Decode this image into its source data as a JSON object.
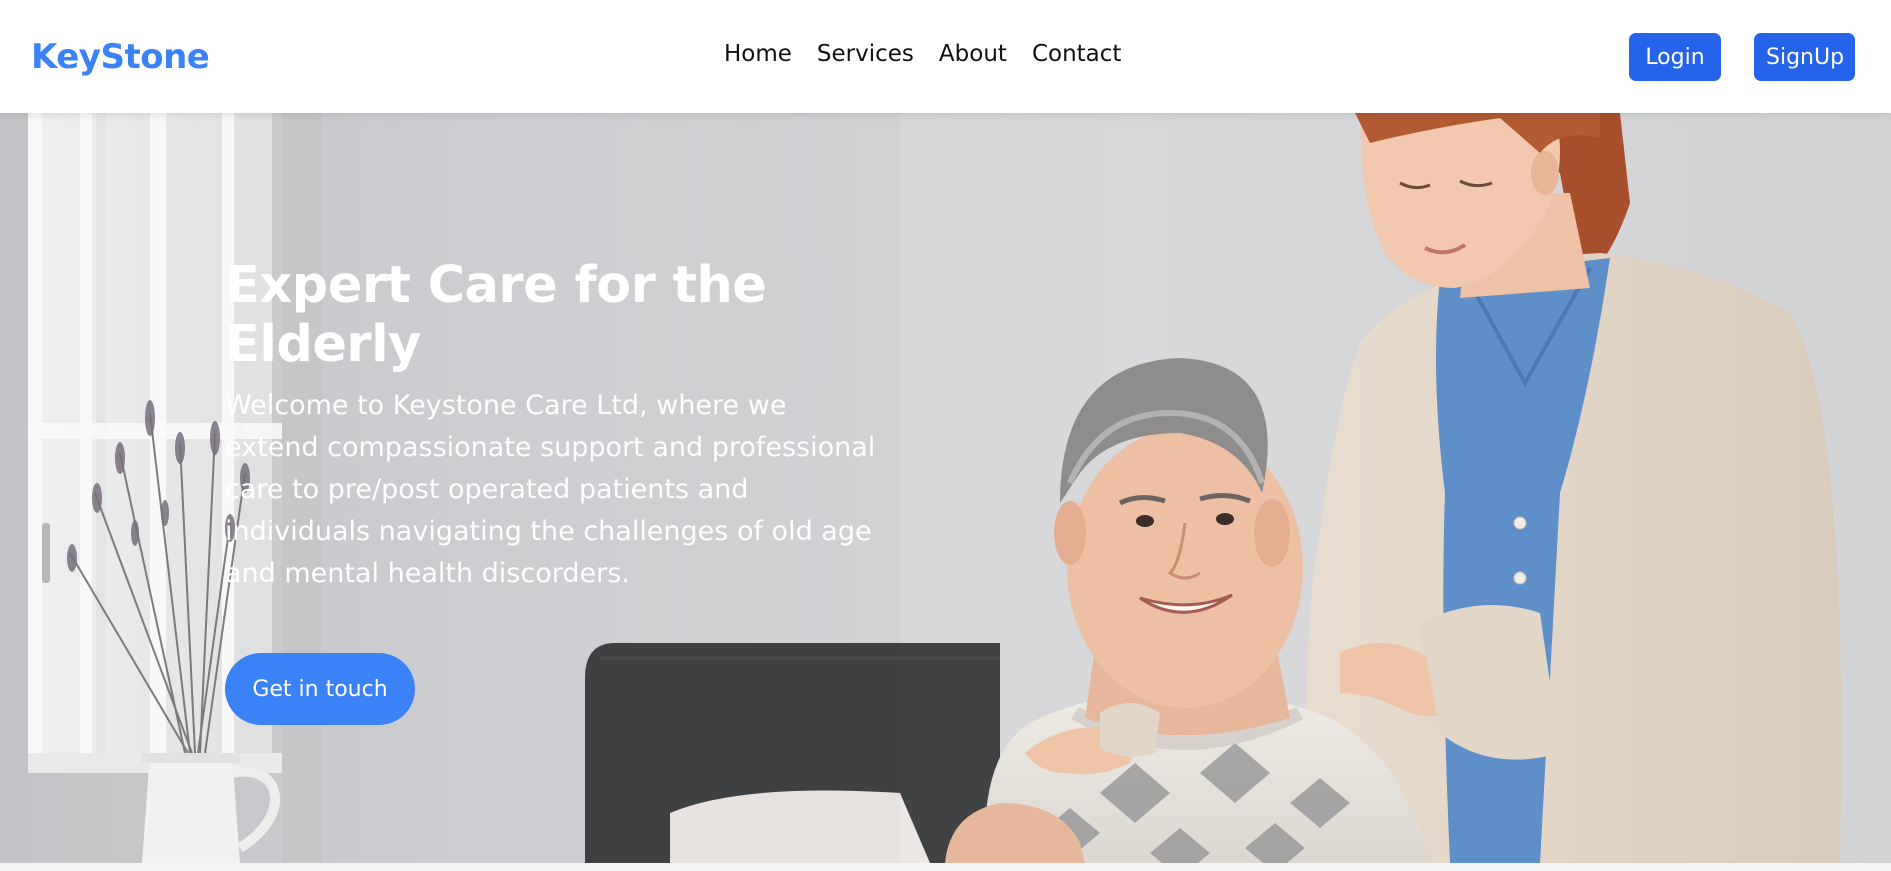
{
  "header": {
    "brand": "KeyStone",
    "nav": [
      "Home",
      "Services",
      "About",
      "Contact"
    ],
    "login_label": "Login",
    "signup_label": "SignUp"
  },
  "hero": {
    "title": "Expert Care for the Elderly",
    "description": "Welcome to Keystone Care Ltd, where we extend compassionate support and professional care to pre/post operated patients and individuals navigating the challenges of old age and mental health discorders.",
    "cta_label": "Get in touch"
  },
  "colors": {
    "brand": "#3b82f6",
    "button": "#2563eb",
    "nav_text": "#111111"
  },
  "icons": []
}
